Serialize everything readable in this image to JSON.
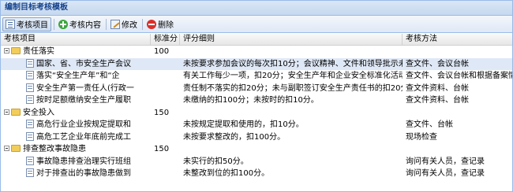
{
  "panel_title": "编制目标考核模板",
  "toolbar": {
    "items_label": "考核项目",
    "content_label": "考核内容",
    "edit_label": "修改",
    "delete_label": "删除"
  },
  "columns": [
    "考核项目",
    "标准分",
    "评分细则",
    "考核方法"
  ],
  "rows": [
    {
      "type": "group",
      "name": "责任落实",
      "score": "100",
      "rule": "",
      "method": ""
    },
    {
      "type": "item",
      "name": "国家、省、市安全生产会议",
      "score": "",
      "rule": "未按要求参加会议的每次扣10分；会议精神、文件和领导批示未及",
      "method": "查文件、会议台帐"
    },
    {
      "type": "item",
      "name": "落实“安全生产年”和“企",
      "score": "",
      "rule": "有关工作每少一项，扣20分；安全生产年和企业安全标准化活动第",
      "method": "查文件、会议台帐和根据备案情况"
    },
    {
      "type": "item",
      "name": "安全生产第一责任人(行政一",
      "score": "",
      "rule": "责任制不落实的扣20分；未与副职签订安全生产责任书的扣20分。",
      "method": "查文件资料、台帐"
    },
    {
      "type": "item",
      "name": "按时足额缴纳安全生产履职",
      "score": "",
      "rule": "未缴纳的扣100分；未按时的扣10分。",
      "method": "查文件资料、台帐"
    },
    {
      "type": "group",
      "name": "安全投入",
      "score": "150",
      "rule": "",
      "method": ""
    },
    {
      "type": "item",
      "name": "高危行业企业按规定提取和",
      "score": "",
      "rule": "未按规定提取和使用的，扣10分。",
      "method": "查文件、台帐"
    },
    {
      "type": "item",
      "name": "高危工艺企业年底前完成工",
      "score": "",
      "rule": "未按要求整改的，扣100分。",
      "method": "现场检查"
    },
    {
      "type": "group",
      "name": "排查整改事故隐患",
      "score": "150",
      "rule": "",
      "method": ""
    },
    {
      "type": "item",
      "name": "事故隐患排查治理实行班组",
      "score": "",
      "rule": "未实行的扣50分。",
      "method": "询问有关人员，查记录"
    },
    {
      "type": "item",
      "name": "对于排查出的事故隐患做到",
      "score": "",
      "rule": "未整改到位的扣100分。",
      "method": "询问有关人员，查记录"
    }
  ]
}
